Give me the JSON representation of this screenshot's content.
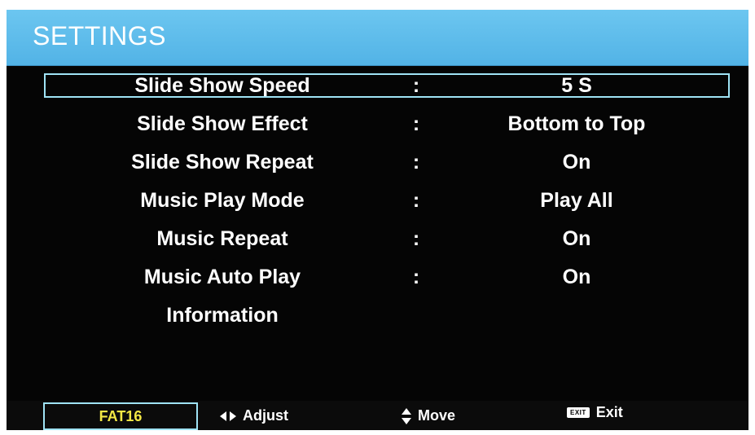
{
  "header": {
    "title": "SETTINGS"
  },
  "menu": {
    "items": [
      {
        "label": "Slide Show Speed",
        "colon": ":",
        "value": "5 S",
        "selected": true
      },
      {
        "label": "Slide Show Effect",
        "colon": ":",
        "value": "Bottom to Top"
      },
      {
        "label": "Slide Show Repeat",
        "colon": ":",
        "value": "On"
      },
      {
        "label": "Music Play Mode",
        "colon": ":",
        "value": "Play All"
      },
      {
        "label": "Music Repeat",
        "colon": ":",
        "value": "On"
      },
      {
        "label": "Music Auto Play",
        "colon": ":",
        "value": "On"
      },
      {
        "label": "Information",
        "colon": "",
        "value": ""
      }
    ]
  },
  "footer": {
    "filesystem": "FAT16",
    "adjust_label": "Adjust",
    "move_label": "Move",
    "exit_badge": "EXIT",
    "exit_label": "Exit"
  },
  "colors": {
    "header_bg": "#5fbdec",
    "screen_bg": "#050505",
    "selection_border": "#9fe3f5",
    "filesystem_text": "#f3e845",
    "text": "#ffffff"
  },
  "icons": {
    "adjust": "left-right-arrows-icon",
    "move": "up-down-arrows-icon",
    "exit": "exit-key-icon"
  }
}
